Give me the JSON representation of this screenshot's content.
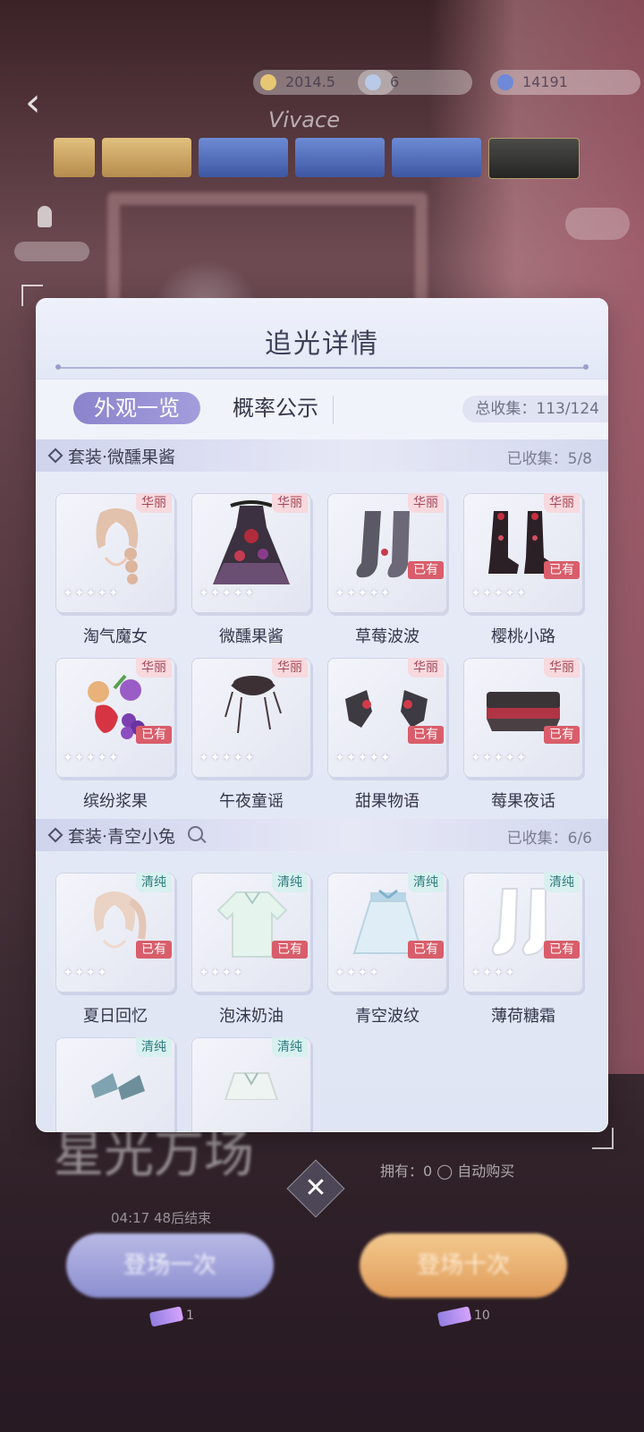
{
  "background": {
    "currencies": [
      "2014.5",
      "6",
      "14191"
    ],
    "top_title": "Vivace",
    "behind_title": "星光万场",
    "behind_info": "拥有：0  ◯ 自动购买",
    "timer": "04:17 48后结束",
    "draw_once": "登场一次",
    "draw_ten": "登场十次",
    "ticket_count_once": "1",
    "ticket_count_ten": "10"
  },
  "modal": {
    "title": "追光详情",
    "tab_active": "外观一览",
    "tab_other": "概率公示",
    "total": "总收集：113/124"
  },
  "sections": [
    {
      "name": "套装·微醺果酱",
      "count": "已收集：5/8",
      "items": [
        {
          "name": "淘气魔女",
          "tag": "华丽",
          "owned": "",
          "stars": "✦✦✦✦✦",
          "icon": "hair-icon"
        },
        {
          "name": "微醺果酱",
          "tag": "华丽",
          "owned": "",
          "stars": "✦✦✦✦✦",
          "icon": "dress-icon"
        },
        {
          "name": "草莓波波",
          "tag": "华丽",
          "owned": "已有",
          "stars": "✦✦✦✦✦",
          "icon": "stockings-icon"
        },
        {
          "name": "樱桃小路",
          "tag": "华丽",
          "owned": "已有",
          "stars": "✦✦✦✦✦",
          "icon": "boots-icon"
        },
        {
          "name": "缤纷浆果",
          "tag": "华丽",
          "owned": "已有",
          "stars": "✦✦✦✦✦",
          "icon": "berries-icon"
        },
        {
          "name": "午夜童谣",
          "tag": "华丽",
          "owned": "",
          "stars": "✦✦✦✦✦",
          "icon": "choker-icon"
        },
        {
          "name": "甜果物语",
          "tag": "华丽",
          "owned": "已有",
          "stars": "✦✦✦✦✦",
          "icon": "hairclip-icon"
        },
        {
          "name": "莓果夜话",
          "tag": "华丽",
          "owned": "已有",
          "stars": "✦✦✦✦✦",
          "icon": "bracelet-icon"
        }
      ]
    },
    {
      "name": "套装·青空小兔",
      "count": "已收集：6/6",
      "items": [
        {
          "name": "夏日回忆",
          "tag": "清纯",
          "owned": "已有",
          "stars": "✦✦✦✦",
          "icon": "ponytail-icon"
        },
        {
          "name": "泡沫奶油",
          "tag": "清纯",
          "owned": "已有",
          "stars": "✦✦✦✦",
          "icon": "blouse-icon"
        },
        {
          "name": "青空波纹",
          "tag": "清纯",
          "owned": "已有",
          "stars": "✦✦✦✦",
          "icon": "skirt-icon"
        },
        {
          "name": "薄荷糖霜",
          "tag": "清纯",
          "owned": "已有",
          "stars": "✦✦✦✦",
          "icon": "socks-icon"
        },
        {
          "name": "",
          "tag": "清纯",
          "owned": "",
          "stars": "",
          "icon": "shoes-icon"
        },
        {
          "name": "",
          "tag": "清纯",
          "owned": "",
          "stars": "",
          "icon": "jacket-icon"
        }
      ]
    }
  ],
  "colors": {
    "accent": "#8b84cc",
    "owned_badge": "#d95d6a",
    "tag_gorgeous": "#f7d9de",
    "tag_pure": "#d8f0ef"
  }
}
